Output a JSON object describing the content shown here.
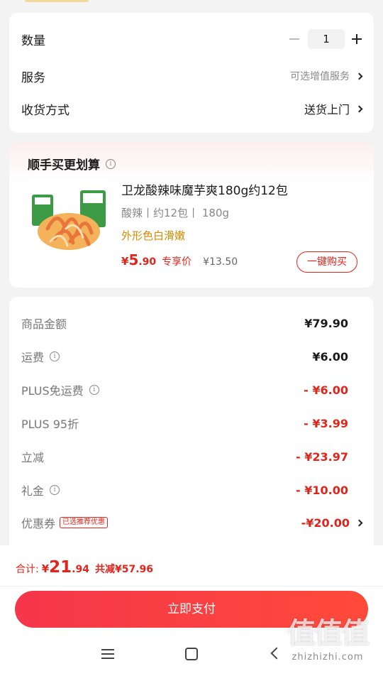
{
  "order": {
    "qty_label": "数量",
    "qty_value": "1",
    "service_label": "服务",
    "service_value": "可选增值服务",
    "delivery_label": "收货方式",
    "delivery_value": "送货上门"
  },
  "addon": {
    "title": "顺手买更划算",
    "product_name": "卫龙酸辣味魔芋爽180g约12包",
    "spec": "酸辣丨约12包丨 180g",
    "tagline": "外形色白滑嫩",
    "price_symbol": "¥",
    "price_int": "5",
    "price_dec": ".90",
    "price_label": "专享价",
    "orig_price": "¥13.50",
    "buy_button": "一键购买"
  },
  "summary": [
    {
      "label": "商品金额",
      "value": "¥79.90",
      "info": false,
      "red": false
    },
    {
      "label": "运费",
      "value": "¥6.00",
      "info": true,
      "red": false
    },
    {
      "label": "PLUS免运费",
      "value": "- ¥6.00",
      "info": true,
      "red": true
    },
    {
      "label": "PLUS 95折",
      "value": "- ¥3.99",
      "info": false,
      "red": true
    },
    {
      "label": "立减",
      "value": "- ¥23.97",
      "info": false,
      "red": true
    },
    {
      "label": "礼金",
      "value": "- ¥10.00",
      "info": true,
      "red": true
    },
    {
      "label": "优惠券",
      "value": "-¥20.00",
      "info": false,
      "red": true,
      "tag": "已选推荐优惠"
    }
  ],
  "footer": {
    "total_label": "合计: ",
    "total_symbol": "¥",
    "total_int": "21",
    "total_dec": ".94",
    "saved": "共减¥57.96",
    "pay_button": "立即支付"
  },
  "watermark": "值值值",
  "watermark_url": "zhizhizhi.com",
  "colors": {
    "accent": "#e1251b",
    "price_orange": "#d58a00"
  }
}
